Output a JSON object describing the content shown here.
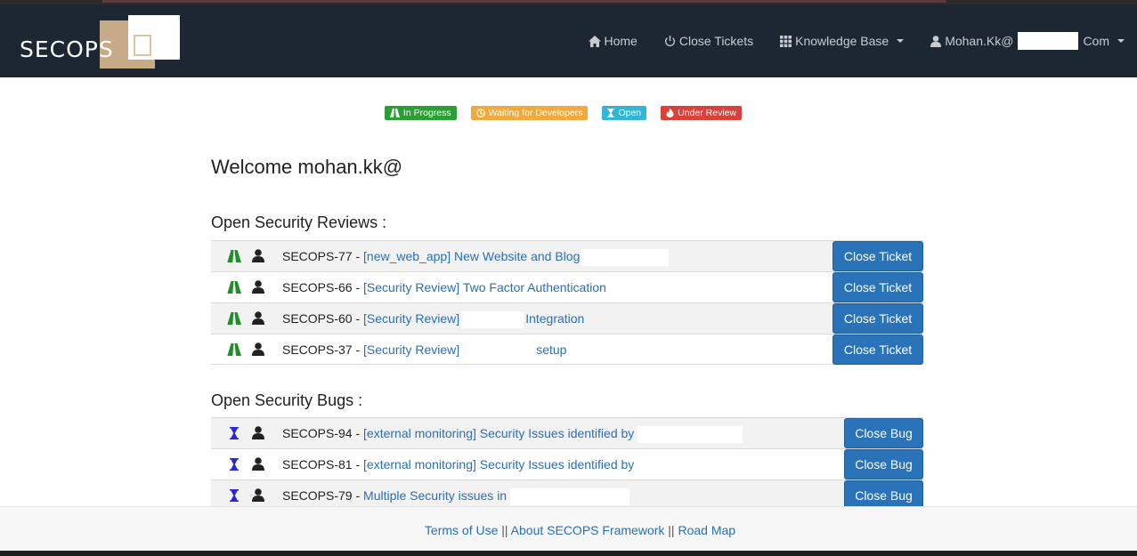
{
  "brand": {
    "logo_text": "SECOPS"
  },
  "nav": {
    "home": "Home",
    "close_tickets": "Close Tickets",
    "knowledge_base": "Knowledge Base",
    "user_prefix": "Mohan.Kk@",
    "user_suffix": "Com"
  },
  "legend": [
    {
      "label": "In Progress",
      "color": "#2aa034"
    },
    {
      "label": "Waiting for Developers",
      "color": "#f0a93a"
    },
    {
      "label": "Open",
      "color": "#33b5d6"
    },
    {
      "label": "Under Review",
      "color": "#d9413a"
    }
  ],
  "welcome": "Welcome mohan.kk@",
  "reviews": {
    "title": "Open Security Reviews :",
    "button_label": "Close Ticket",
    "rows": [
      {
        "id": "SECOPS-77 - ",
        "prefix": "[new_web_app]",
        "text": " New Website and Blog",
        "suffix": ""
      },
      {
        "id": "SECOPS-66 - ",
        "prefix": "[Security Review]",
        "text": " Two Factor Authentication",
        "suffix": ""
      },
      {
        "id": "SECOPS-60 - ",
        "prefix": "[Security Review]",
        "text": "",
        "suffix": "Integration"
      },
      {
        "id": "SECOPS-37 - ",
        "prefix": "[Security Review]",
        "text": "",
        "suffix": "setup"
      }
    ]
  },
  "bugs": {
    "title": "Open Security Bugs :",
    "button_label": "Close Bug",
    "rows": [
      {
        "id": "SECOPS-94 - ",
        "prefix": "[external monitoring]",
        "text": " Security Issues identified by"
      },
      {
        "id": "SECOPS-81 - ",
        "prefix": "[external monitoring]",
        "text": " Security Issues identified by"
      },
      {
        "id": "SECOPS-79 - ",
        "prefix": "",
        "text": "Multiple Security issues in"
      }
    ]
  },
  "footer": {
    "terms": "Terms of Use",
    "sep": " || ",
    "about": "About SECOPS Framework",
    "roadmap": "Road Map"
  }
}
